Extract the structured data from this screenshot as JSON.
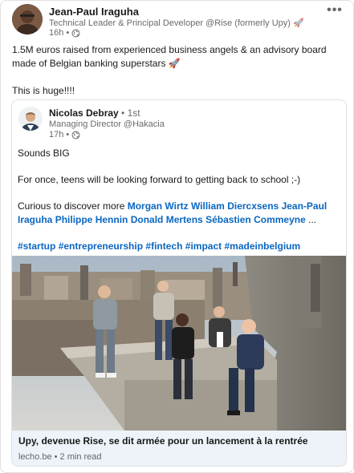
{
  "post": {
    "author_name": "Jean-Paul Iraguha",
    "author_headline": "Technical Leader & Principal Developer @Rise (formerly Upy) 🚀",
    "time": "16h",
    "meta_separator": "•",
    "more_label": "•••",
    "text_line1": "1.5M euros raised from experienced business angels & an advisory board made of Belgian banking superstars 🚀",
    "text_line2": "This is huge!!!!"
  },
  "shared": {
    "author_name": "Nicolas Debray",
    "degree": " • 1st",
    "author_headline": "Managing Director @Hakacia",
    "time": "17h",
    "meta_separator": "•",
    "text_p1": "Sounds BIG",
    "text_p2": "For once, teens will be looking forward to getting back to school ;-)",
    "text_p3_prefix": "Curious to discover more ",
    "mentions": [
      "Morgan Wirtz",
      "William Diercxsens",
      "Jean-Paul Iraguha",
      "Philippe Hennin",
      "Donald Mertens",
      "Sébastien Commeyne"
    ],
    "ellipsis": "...",
    "hashtags": [
      "#startup",
      "#entrepreneurship",
      "#fintech",
      "#impact",
      "#madeinbelgium"
    ]
  },
  "article": {
    "title": "Upy, devenue Rise, se dit armée pour un lancement à la rentrée",
    "source": "lecho.be • 2 min read"
  },
  "colors": {
    "link": "#0a66c2",
    "footer_bg": "#edf3f8",
    "border": "#e0e0e0"
  },
  "icons": [
    "globe-icon",
    "more-icon"
  ]
}
